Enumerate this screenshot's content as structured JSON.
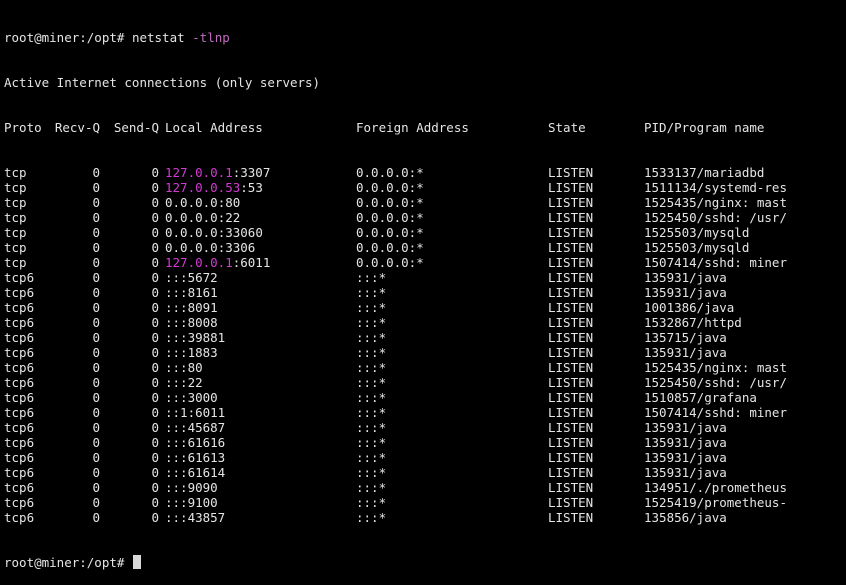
{
  "command_line": {
    "prompt": "root@miner:/opt# ",
    "command": "netstat ",
    "flag": "-tlnp"
  },
  "banner": "Active Internet connections (only servers)",
  "header": {
    "proto": "Proto",
    "recvq": "Recv-Q",
    "sendq": "Send-Q",
    "local": "Local Address",
    "foreign": "Foreign Address",
    "state": "State",
    "pid": "PID/Program name"
  },
  "rows": [
    {
      "proto": "tcp",
      "recvq": "0",
      "sendq": "0",
      "local_ip": "127.0.0.1",
      "local_port": ":3307",
      "loopback": true,
      "foreign": "0.0.0.0:*",
      "state": "LISTEN",
      "pid": "1533137/mariadbd"
    },
    {
      "proto": "tcp",
      "recvq": "0",
      "sendq": "0",
      "local_ip": "127.0.0.53",
      "local_port": ":53",
      "loopback": true,
      "foreign": "0.0.0.0:*",
      "state": "LISTEN",
      "pid": "1511134/systemd-res"
    },
    {
      "proto": "tcp",
      "recvq": "0",
      "sendq": "0",
      "local_ip": "0.0.0.0",
      "local_port": ":80",
      "loopback": false,
      "foreign": "0.0.0.0:*",
      "state": "LISTEN",
      "pid": "1525435/nginx: mast"
    },
    {
      "proto": "tcp",
      "recvq": "0",
      "sendq": "0",
      "local_ip": "0.0.0.0",
      "local_port": ":22",
      "loopback": false,
      "foreign": "0.0.0.0:*",
      "state": "LISTEN",
      "pid": "1525450/sshd: /usr/"
    },
    {
      "proto": "tcp",
      "recvq": "0",
      "sendq": "0",
      "local_ip": "0.0.0.0",
      "local_port": ":33060",
      "loopback": false,
      "foreign": "0.0.0.0:*",
      "state": "LISTEN",
      "pid": "1525503/mysqld"
    },
    {
      "proto": "tcp",
      "recvq": "0",
      "sendq": "0",
      "local_ip": "0.0.0.0",
      "local_port": ":3306",
      "loopback": false,
      "foreign": "0.0.0.0:*",
      "state": "LISTEN",
      "pid": "1525503/mysqld"
    },
    {
      "proto": "tcp",
      "recvq": "0",
      "sendq": "0",
      "local_ip": "127.0.0.1",
      "local_port": ":6011",
      "loopback": true,
      "foreign": "0.0.0.0:*",
      "state": "LISTEN",
      "pid": "1507414/sshd: miner"
    },
    {
      "proto": "tcp6",
      "recvq": "0",
      "sendq": "0",
      "local_ip": ":::",
      "local_port": "5672",
      "loopback": false,
      "foreign": ":::*",
      "state": "LISTEN",
      "pid": "135931/java"
    },
    {
      "proto": "tcp6",
      "recvq": "0",
      "sendq": "0",
      "local_ip": ":::",
      "local_port": "8161",
      "loopback": false,
      "foreign": ":::*",
      "state": "LISTEN",
      "pid": "135931/java"
    },
    {
      "proto": "tcp6",
      "recvq": "0",
      "sendq": "0",
      "local_ip": ":::",
      "local_port": "8091",
      "loopback": false,
      "foreign": ":::*",
      "state": "LISTEN",
      "pid": "1001386/java"
    },
    {
      "proto": "tcp6",
      "recvq": "0",
      "sendq": "0",
      "local_ip": ":::",
      "local_port": "8008",
      "loopback": false,
      "foreign": ":::*",
      "state": "LISTEN",
      "pid": "1532867/httpd"
    },
    {
      "proto": "tcp6",
      "recvq": "0",
      "sendq": "0",
      "local_ip": ":::",
      "local_port": "39881",
      "loopback": false,
      "foreign": ":::*",
      "state": "LISTEN",
      "pid": "135715/java"
    },
    {
      "proto": "tcp6",
      "recvq": "0",
      "sendq": "0",
      "local_ip": ":::",
      "local_port": "1883",
      "loopback": false,
      "foreign": ":::*",
      "state": "LISTEN",
      "pid": "135931/java"
    },
    {
      "proto": "tcp6",
      "recvq": "0",
      "sendq": "0",
      "local_ip": ":::",
      "local_port": "80",
      "loopback": false,
      "foreign": ":::*",
      "state": "LISTEN",
      "pid": "1525435/nginx: mast"
    },
    {
      "proto": "tcp6",
      "recvq": "0",
      "sendq": "0",
      "local_ip": ":::",
      "local_port": "22",
      "loopback": false,
      "foreign": ":::*",
      "state": "LISTEN",
      "pid": "1525450/sshd: /usr/"
    },
    {
      "proto": "tcp6",
      "recvq": "0",
      "sendq": "0",
      "local_ip": ":::",
      "local_port": "3000",
      "loopback": false,
      "foreign": ":::*",
      "state": "LISTEN",
      "pid": "1510857/grafana"
    },
    {
      "proto": "tcp6",
      "recvq": "0",
      "sendq": "0",
      "local_ip": "::1",
      "local_port": ":6011",
      "loopback": false,
      "foreign": ":::*",
      "state": "LISTEN",
      "pid": "1507414/sshd: miner"
    },
    {
      "proto": "tcp6",
      "recvq": "0",
      "sendq": "0",
      "local_ip": ":::",
      "local_port": "45687",
      "loopback": false,
      "foreign": ":::*",
      "state": "LISTEN",
      "pid": "135931/java"
    },
    {
      "proto": "tcp6",
      "recvq": "0",
      "sendq": "0",
      "local_ip": ":::",
      "local_port": "61616",
      "loopback": false,
      "foreign": ":::*",
      "state": "LISTEN",
      "pid": "135931/java"
    },
    {
      "proto": "tcp6",
      "recvq": "0",
      "sendq": "0",
      "local_ip": ":::",
      "local_port": "61613",
      "loopback": false,
      "foreign": ":::*",
      "state": "LISTEN",
      "pid": "135931/java"
    },
    {
      "proto": "tcp6",
      "recvq": "0",
      "sendq": "0",
      "local_ip": ":::",
      "local_port": "61614",
      "loopback": false,
      "foreign": ":::*",
      "state": "LISTEN",
      "pid": "135931/java"
    },
    {
      "proto": "tcp6",
      "recvq": "0",
      "sendq": "0",
      "local_ip": ":::",
      "local_port": "9090",
      "loopback": false,
      "foreign": ":::*",
      "state": "LISTEN",
      "pid": "134951/./prometheus"
    },
    {
      "proto": "tcp6",
      "recvq": "0",
      "sendq": "0",
      "local_ip": ":::",
      "local_port": "9100",
      "loopback": false,
      "foreign": ":::*",
      "state": "LISTEN",
      "pid": "1525419/prometheus-"
    },
    {
      "proto": "tcp6",
      "recvq": "0",
      "sendq": "0",
      "local_ip": ":::",
      "local_port": "43857",
      "loopback": false,
      "foreign": ":::*",
      "state": "LISTEN",
      "pid": "135856/java"
    }
  ],
  "final_prompt": "root@miner:/opt# ",
  "colors": {
    "background": "#000000",
    "text": "#e5e5e5",
    "loopback_ip": "#d23ad2",
    "option_flag": "#c06bc0",
    "cursor": "#d8d8d8"
  }
}
